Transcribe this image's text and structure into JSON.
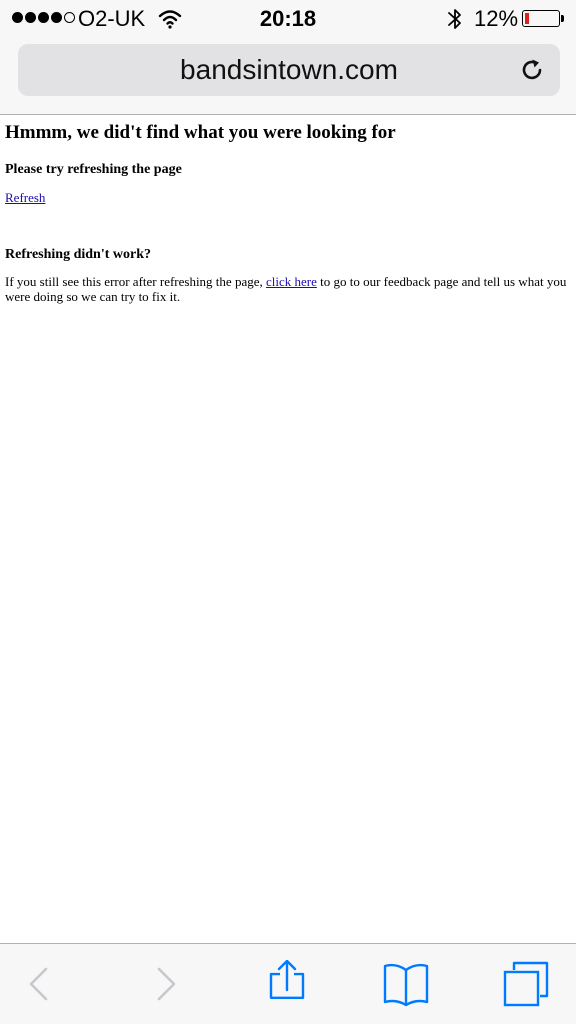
{
  "status_bar": {
    "carrier": "O2-UK",
    "time": "20:18",
    "battery_percent": "12%",
    "battery_level": 0.12,
    "signal_bars": 4,
    "signal_total": 5
  },
  "browser": {
    "url": "bandsintown.com"
  },
  "page": {
    "heading": "Hmmm, we did't find what you were looking for",
    "subheading": "Please try refreshing the page",
    "refresh_link": "Refresh",
    "subheading2": "Refreshing didn't work?",
    "body_before_link": "If you still see this error after refreshing the page, ",
    "body_link": "click here",
    "body_after_link": " to go to our feedback page and tell us what you were doing so we can try to fix it."
  },
  "toolbar": {
    "icons": [
      "back-icon",
      "forward-icon",
      "share-icon",
      "bookmarks-icon",
      "tabs-icon"
    ]
  },
  "colors": {
    "accent": "#007aff",
    "disabled": "#c7c7cc",
    "link": "#1a0dab",
    "battery_low": "#e0201b"
  }
}
